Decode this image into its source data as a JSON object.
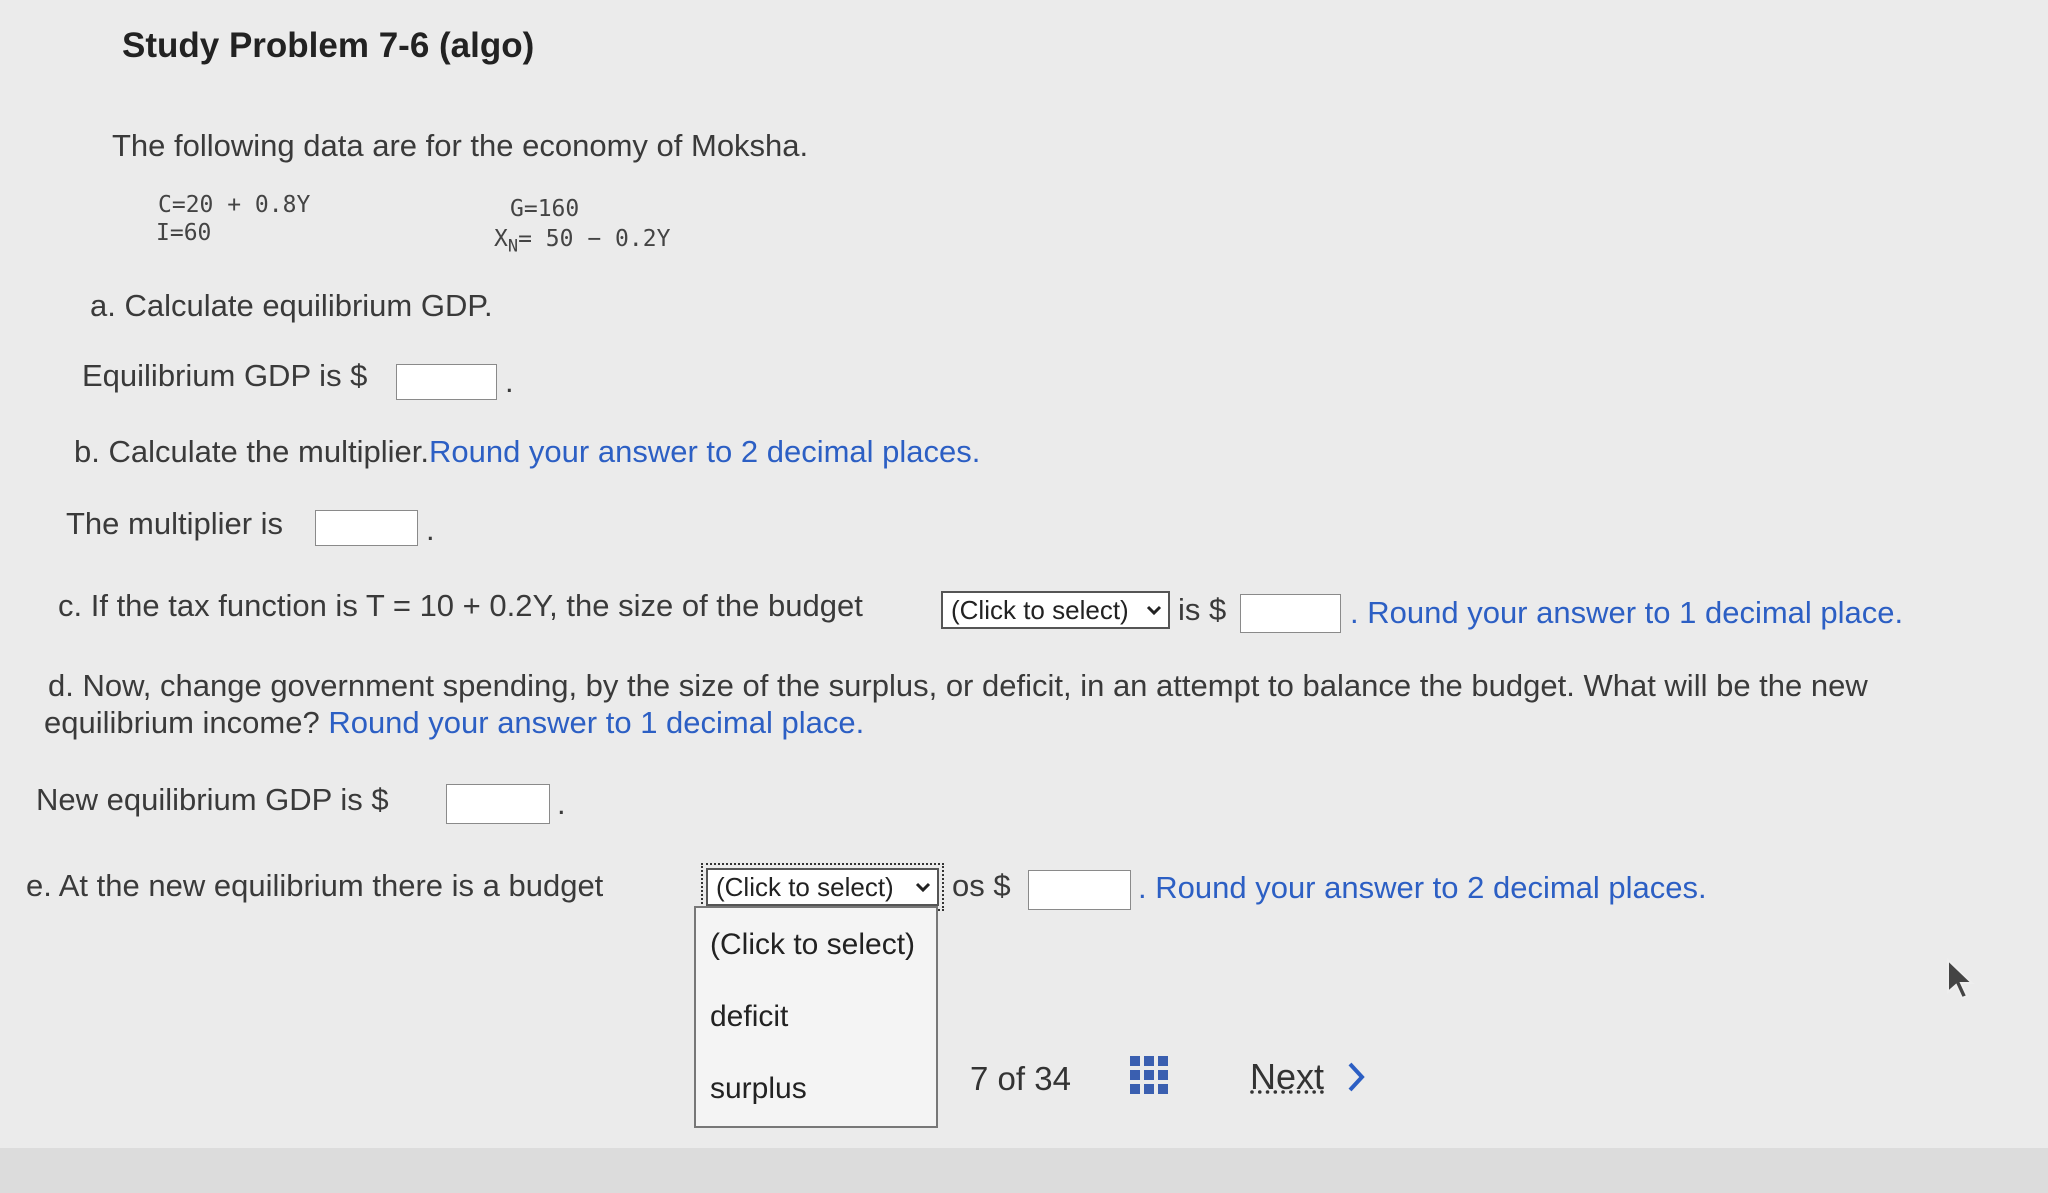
{
  "title": "Study Problem 7-6 (algo)",
  "intro": "The following data are for the economy of Moksha.",
  "equations": {
    "c": "C=20 + 0.8Y",
    "i": "I=60",
    "g": "G=160",
    "xn_symbol": "X",
    "xn_sub": "N",
    "xn_rest": "= 50 − 0.2Y"
  },
  "part_a": {
    "question": "a. Calculate equilibrium GDP.",
    "answer_label": "Equilibrium GDP is $",
    "answer_value": ""
  },
  "part_b": {
    "question": "b. Calculate the multiplier.",
    "instruction": "Round your answer to 2 decimal places.",
    "answer_label": "The multiplier is",
    "answer_value": ""
  },
  "part_c": {
    "question": "c. If the tax function is T = 10 + 0.2Y, the size of the budget",
    "select_value": "(Click to select)",
    "mid_text": "is $",
    "answer_value": "",
    "instruction": "Round your answer to 1 decimal place."
  },
  "part_d": {
    "question_line1": "d. Now, change government spending, by the size of the surplus, or deficit, in an attempt to balance the budget. What will be the new",
    "question_line2": "equilibrium income?",
    "instruction": "Round your answer to 1 decimal place.",
    "answer_label": "New equilibrium GDP is $",
    "answer_value": ""
  },
  "part_e": {
    "question": "e. At the new equilibrium there is a budget",
    "select_value": "(Click to select)",
    "mid_text": "os $",
    "answer_value": "",
    "instruction": "Round your answer to 2 decimal places.",
    "dropdown_options": [
      "(Click to select)",
      "deficit",
      "surplus"
    ]
  },
  "pager": {
    "current": "7",
    "of": "of",
    "total": "34",
    "next_label": "Next"
  },
  "icons": {
    "chevron_down": "chevron-down-icon",
    "grid": "grid-icon",
    "next_chevron": "chevron-right-icon",
    "cursor": "cursor-icon"
  },
  "colors": {
    "accent_blue": "#2c5fc4",
    "background": "#ebebeb"
  }
}
